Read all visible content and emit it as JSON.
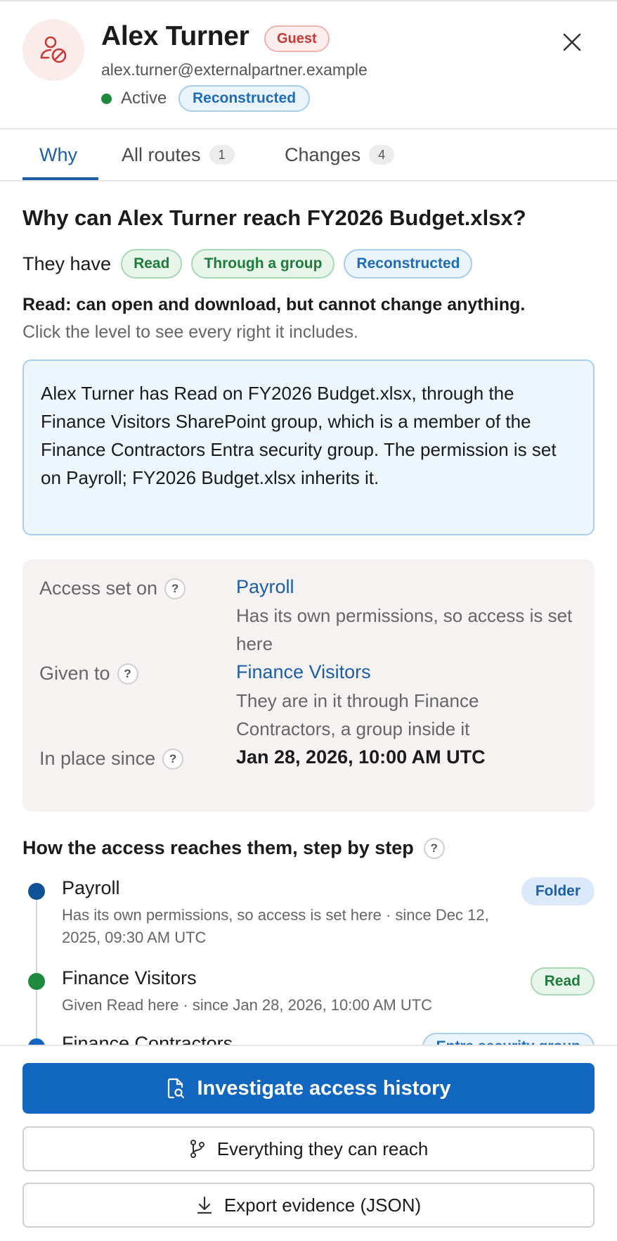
{
  "header": {
    "name": "Alex Turner",
    "guest_badge": "Guest",
    "email": "alex.turner@externalpartner.example",
    "status": "Active",
    "status_color": "#1f8a3d",
    "reconstructed_badge": "Reconstructed",
    "avatar_icon": "guest-user-blocked-icon",
    "close_icon": "close-icon"
  },
  "tabs": [
    {
      "label": "Why",
      "active": true
    },
    {
      "label": "All routes",
      "count": "1"
    },
    {
      "label": "Changes",
      "count": "4"
    }
  ],
  "why": {
    "question": "Why can Alex Turner reach FY2026 Budget.xlsx?",
    "they_have": "They have",
    "badges": [
      "Read",
      "Through a group",
      "Reconstructed"
    ],
    "level_description": "Read: can open and download, but cannot change anything.",
    "level_hint": "Click the level to see every right it includes.",
    "explanation": "Alex Turner has Read on FY2026 Budget.xlsx, through the Finance Visitors SharePoint group, which is a member of the Finance Contractors Entra security group. The permission is set on Payroll; FY2026 Budget.xlsx inherits it."
  },
  "details": {
    "access_set_on_label": "Access set on",
    "access_set_on_value": "Payroll",
    "access_set_on_sub": "Has its own permissions, so access is set here",
    "given_to_label": "Given to",
    "given_to_value": "Finance Visitors",
    "given_to_sub": "They are in it through Finance Contractors, a group inside it",
    "in_place_since_label": "In place since",
    "in_place_since_value": "Jan 28, 2026, 10:00 AM UTC"
  },
  "steps": {
    "title": "How the access reaches them, step by step",
    "items": [
      {
        "name": "Payroll",
        "sub": "Has its own permissions, so access is set here · since Dec 12, 2025, 09:30 AM UTC",
        "tag": "Folder",
        "dot_color": "#0f5295"
      },
      {
        "name": "Finance Visitors",
        "sub": "Given Read here · since Jan 28, 2026, 10:00 AM UTC",
        "tag": "Read",
        "dot_color": "#1f8a3d"
      },
      {
        "name": "Finance Contractors",
        "sub": "",
        "tag": "Entra security group",
        "dot_color": "#1167bf"
      }
    ]
  },
  "footer": {
    "primary_label": "Investigate access history",
    "reach_label": "Everything they can reach",
    "export_label": "Export evidence (JSON)"
  },
  "colors": {
    "accent": "#1167bf",
    "tab_active": "#1b5fa8",
    "guest_red": "#c63a33",
    "green": "#1c7c3a"
  }
}
